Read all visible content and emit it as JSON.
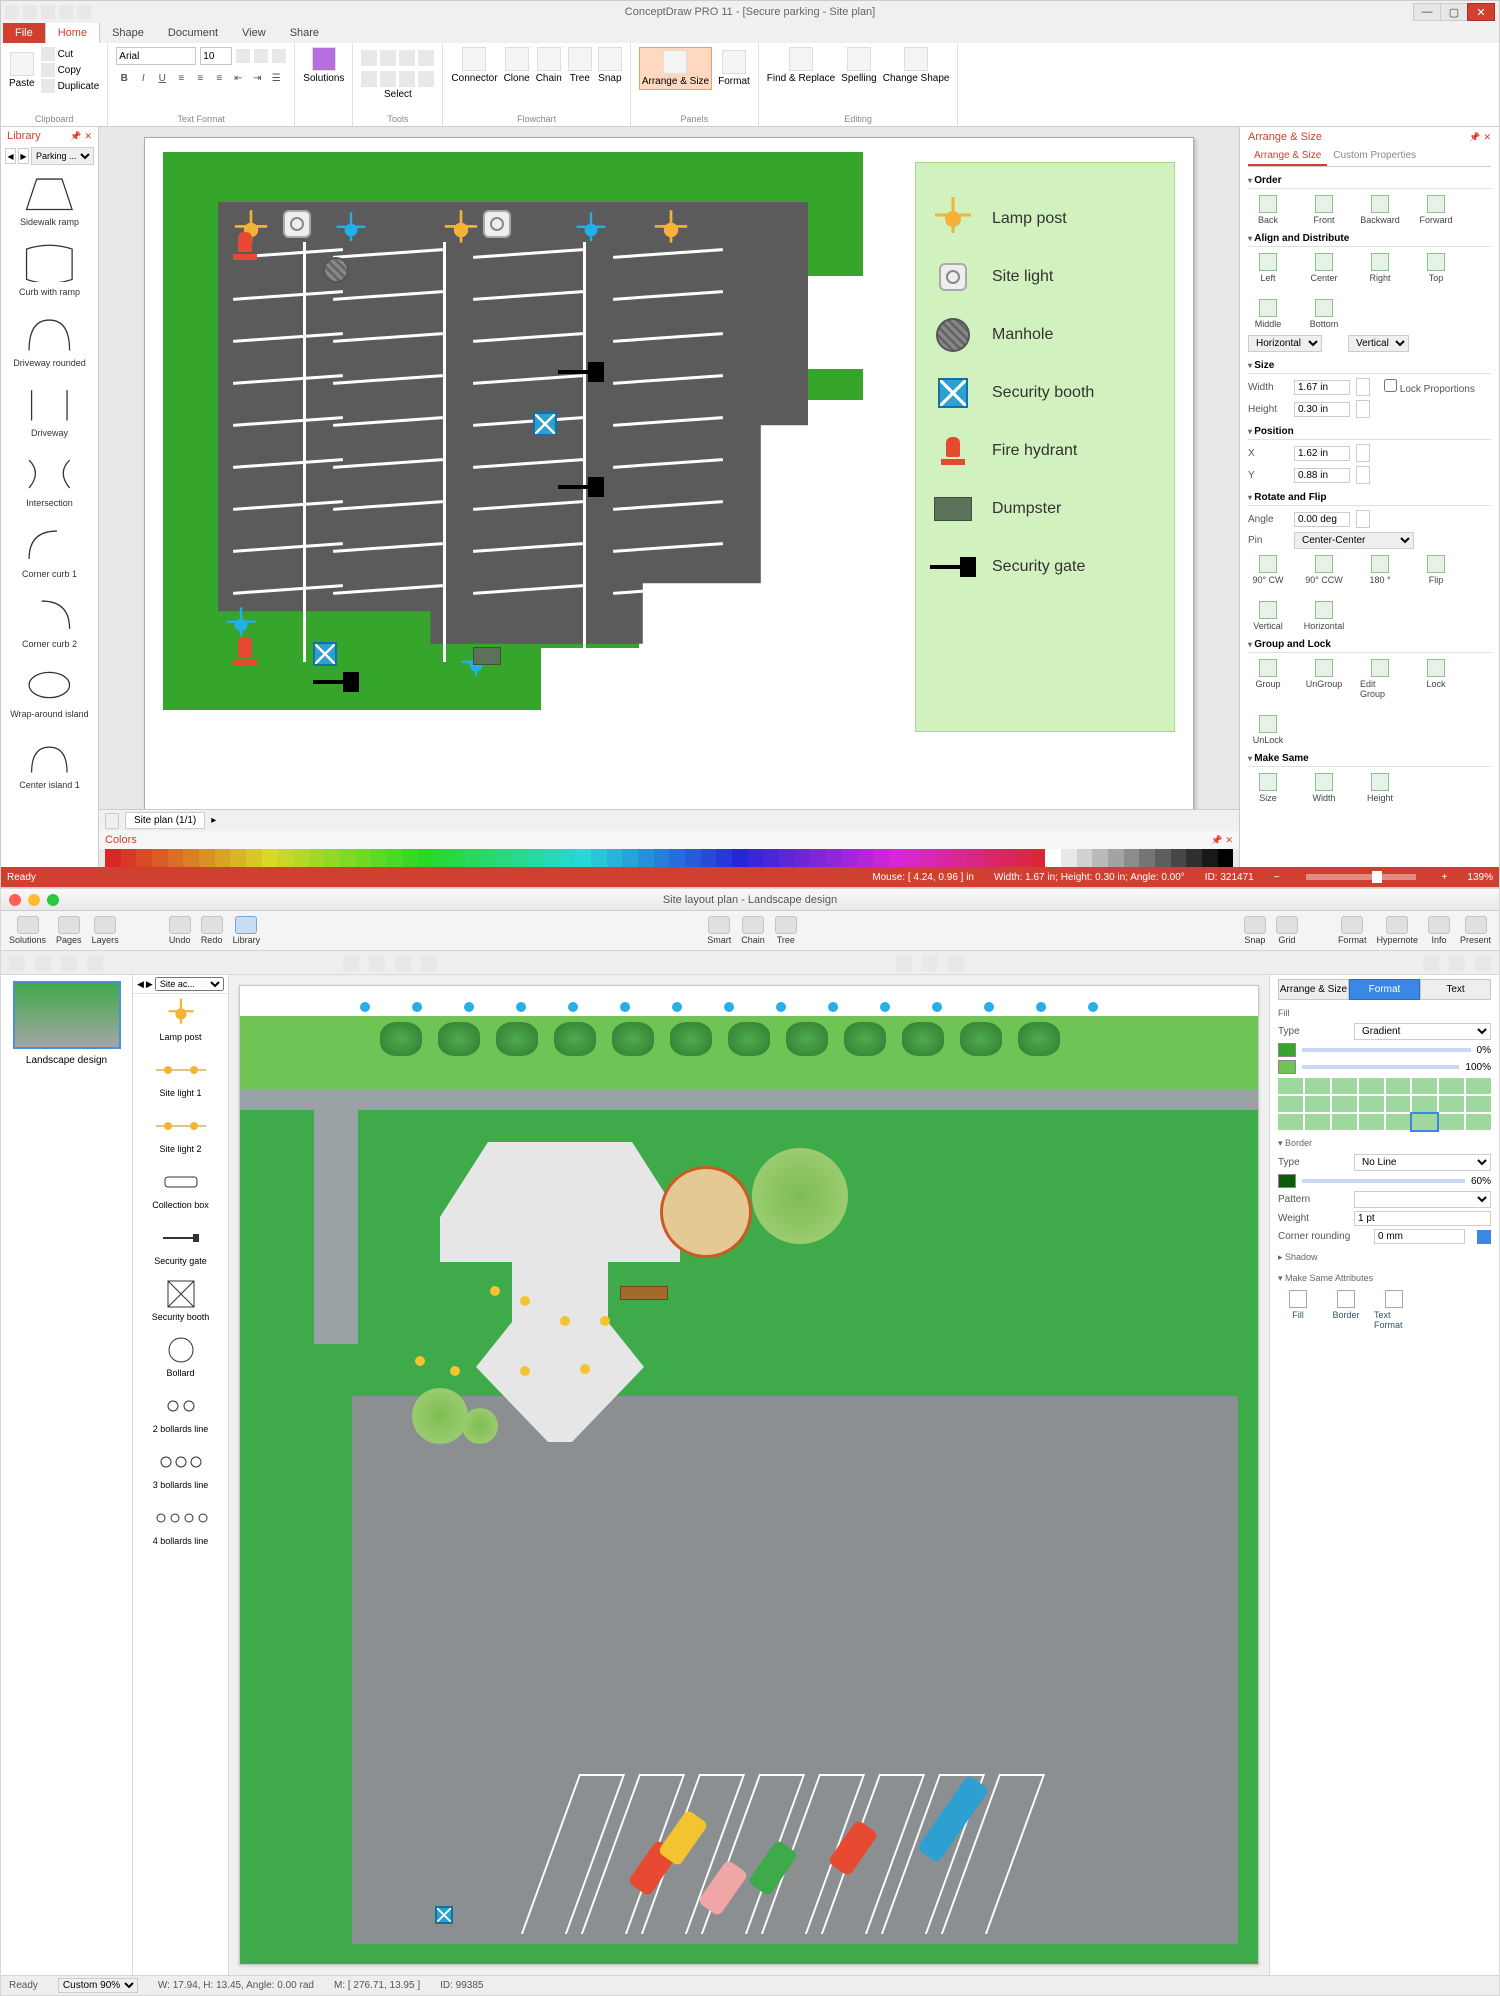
{
  "win": {
    "title": "ConceptDraw PRO 11 - [Secure parking - Site plan]",
    "tabs": [
      "File",
      "Home",
      "Shape",
      "Document",
      "View",
      "Share"
    ],
    "active_tab": "Home",
    "ribbon": {
      "paste": "Paste",
      "cut": "Cut",
      "copy": "Copy",
      "duplicate": "Duplicate",
      "clipboard_label": "Clipboard",
      "font_name": "Arial",
      "font_size": "10",
      "text_format_label": "Text Format",
      "solutions": "Solutions",
      "select": "Select",
      "tools_label": "Tools",
      "connector": "Connector",
      "clone": "Clone",
      "chain": "Chain",
      "tree": "Tree",
      "snap": "Snap",
      "flowchart_label": "Flowchart",
      "arrange_size": "Arrange & Size",
      "format": "Format",
      "panels_label": "Panels",
      "find_replace": "Find & Replace",
      "spelling": "Spelling",
      "change_shape": "Change Shape",
      "editing_label": "Editing"
    },
    "library": {
      "title": "Library",
      "selector": "Parking ...",
      "items": [
        "Sidewalk ramp",
        "Curb with ramp",
        "Driveway rounded",
        "Driveway",
        "Intersection",
        "Corner curb 1",
        "Corner curb 2",
        "Wrap-around island",
        "Center island 1"
      ]
    },
    "legend": [
      "Lamp post",
      "Site light",
      "Manhole",
      "Security booth",
      "Fire hydrant",
      "Dumpster",
      "Security gate"
    ],
    "page_tab": "Site plan (1/1)",
    "colors_title": "Colors",
    "rpanel": {
      "title": "Arrange & Size",
      "tab_a": "Arrange & Size",
      "tab_b": "Custom Properties",
      "sect_order": "Order",
      "order": [
        "Back",
        "Front",
        "Backward",
        "Forward"
      ],
      "sect_align": "Align and Distribute",
      "align": [
        "Left",
        "Center",
        "Right",
        "Top",
        "Middle",
        "Bottom"
      ],
      "align_h": "Horizontal",
      "align_v": "Vertical",
      "sect_size": "Size",
      "width_l": "Width",
      "width_v": "1.67 in",
      "height_l": "Height",
      "height_v": "0.30 in",
      "lock_prop": "Lock Proportions",
      "sect_pos": "Position",
      "x_l": "X",
      "x_v": "1.62 in",
      "y_l": "Y",
      "y_v": "0.88 in",
      "sect_rot": "Rotate and Flip",
      "angle_l": "Angle",
      "angle_v": "0.00 deg",
      "pin_l": "Pin",
      "pin_v": "Center-Center",
      "rot_cmds": [
        "90° CW",
        "90° CCW",
        "180 °",
        "Flip",
        "Vertical",
        "Horizontal"
      ],
      "sect_grp": "Group and Lock",
      "grp_cmds": [
        "Group",
        "UnGroup",
        "Edit Group",
        "Lock",
        "UnLock"
      ],
      "sect_same": "Make Same",
      "same_cmds": [
        "Size",
        "Width",
        "Height"
      ]
    },
    "status": {
      "ready": "Ready",
      "mouse": "Mouse: [ 4.24, 0.96 ] in",
      "dims": "Width: 1.67 in;  Height: 0.30 in;  Angle: 0.00°",
      "id": "ID: 321471",
      "zoom": "139%"
    }
  },
  "mac": {
    "title": "Site layout plan - Landscape design",
    "tool_left": [
      "Solutions",
      "Pages",
      "Layers"
    ],
    "undo": "Undo",
    "redo": "Redo",
    "library": "Library",
    "smart": "Smart",
    "chain": "Chain",
    "tree": "Tree",
    "tool_right": [
      "Snap",
      "Grid",
      "Format",
      "Hypernote",
      "Info",
      "Present"
    ],
    "thumb_label": "Landscape design",
    "lib_selector": "Site ac...",
    "lib_items": [
      "Lamp post",
      "Site light 1",
      "Site light 2",
      "Collection box",
      "Security gate",
      "Security booth",
      "Bollard",
      "2 bollards line",
      "3 bollards line",
      "4 bollards line"
    ],
    "rtabs": [
      "Arrange & Size",
      "Format",
      "Text"
    ],
    "fill_h": "Fill",
    "fill_type_l": "Type",
    "fill_type_v": "Gradient",
    "grad_a": "0%",
    "grad_b": "100%",
    "border_h": "Border",
    "border_type_l": "Type",
    "border_type_v": "No Line",
    "opacity_v": "60%",
    "pattern_l": "Pattern",
    "weight_l": "Weight",
    "weight_v": "1 pt",
    "corner_l": "Corner rounding",
    "corner_v": "0 mm",
    "shadow_h": "Shadow",
    "msa_h": "Make Same Attributes",
    "msa": [
      "Fill",
      "Border",
      "Text Format"
    ],
    "status": {
      "ready": "Ready",
      "zoom_label": "Custom 90%",
      "wh": "W: 17.94,  H: 13.45,  Angle: 0.00 rad",
      "mouse": "M: [ 276.71, 13.95 ]",
      "id": "ID: 99385"
    }
  }
}
